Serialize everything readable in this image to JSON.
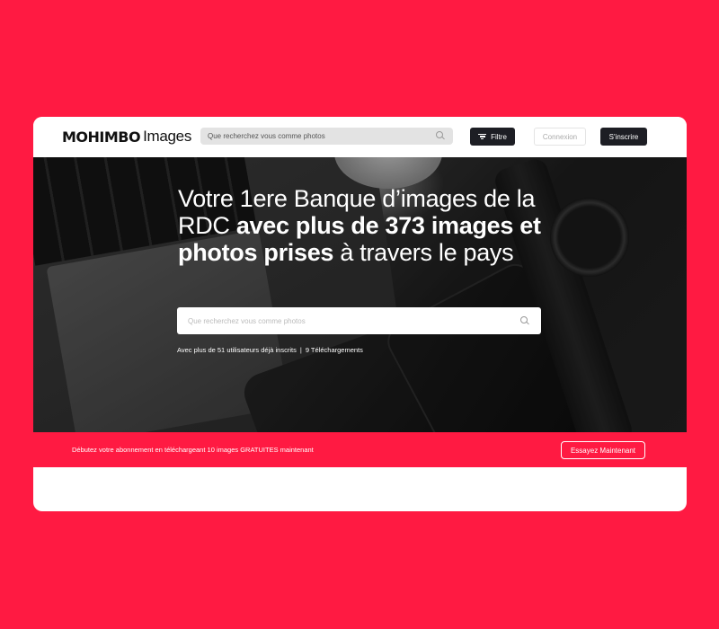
{
  "header": {
    "logo_mark": "MOHIMBO",
    "logo_text": "Images",
    "search_placeholder": "Que recherchez vous comme photos",
    "filter_label": "Filtre",
    "login_label": "Connexion",
    "signup_label": "S'inscrire"
  },
  "hero": {
    "headline_part1": "Votre 1ere Banque d’images de la RDC ",
    "headline_bold": "avec plus de 373 images et photos prises",
    "headline_part2": " à travers le pays",
    "search_placeholder": "Que recherchez vous comme photos",
    "stats_users": "Avec plus de 51 utilisateurs déjà inscrits",
    "stats_sep": "|",
    "stats_downloads": "9 Téléchargements"
  },
  "promo": {
    "text": "Débutez votre abonnement en téléchargeant 10 images GRATUITES maintenant",
    "button_label": "Essayez Maintenant"
  },
  "colors": {
    "background": "#ff1a42",
    "dark_button": "#1d1e24",
    "accent": "#ff1a42"
  }
}
